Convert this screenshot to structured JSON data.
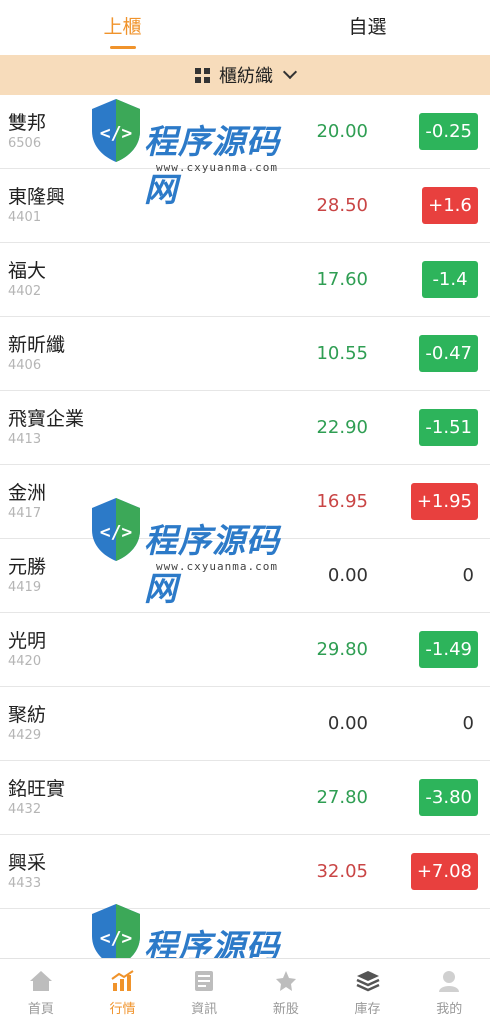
{
  "tabs": [
    {
      "label": "上櫃",
      "active": true
    },
    {
      "label": "自選",
      "active": false
    }
  ],
  "category": {
    "label": "櫃紡織"
  },
  "colors": {
    "accent": "#f0932b",
    "up": "#e8403e",
    "down": "#2db45b",
    "category_bg": "#f7dcbb"
  },
  "stocks": [
    {
      "name": "雙邦",
      "code": "6506",
      "price": "20.00",
      "change": "-0.25",
      "dir": "down"
    },
    {
      "name": "東隆興",
      "code": "4401",
      "price": "28.50",
      "change": "+1.6",
      "dir": "up"
    },
    {
      "name": "福大",
      "code": "4402",
      "price": "17.60",
      "change": "-1.4",
      "dir": "down"
    },
    {
      "name": "新昕纖",
      "code": "4406",
      "price": "10.55",
      "change": "-0.47",
      "dir": "down"
    },
    {
      "name": "飛寶企業",
      "code": "4413",
      "price": "22.90",
      "change": "-1.51",
      "dir": "down"
    },
    {
      "name": "金洲",
      "code": "4417",
      "price": "16.95",
      "change": "+1.95",
      "dir": "up"
    },
    {
      "name": "元勝",
      "code": "4419",
      "price": "0.00",
      "change": "0",
      "dir": "flat"
    },
    {
      "name": "光明",
      "code": "4420",
      "price": "29.80",
      "change": "-1.49",
      "dir": "down"
    },
    {
      "name": "聚紡",
      "code": "4429",
      "price": "0.00",
      "change": "0",
      "dir": "flat"
    },
    {
      "name": "銘旺實",
      "code": "4432",
      "price": "27.80",
      "change": "-3.80",
      "dir": "down"
    },
    {
      "name": "興采",
      "code": "4433",
      "price": "32.05",
      "change": "+7.08",
      "dir": "up"
    }
  ],
  "nav": [
    {
      "label": "首頁",
      "icon": "home-icon",
      "active": false
    },
    {
      "label": "行情",
      "icon": "chart-icon",
      "active": true
    },
    {
      "label": "資訊",
      "icon": "news-icon",
      "active": false
    },
    {
      "label": "新股",
      "icon": "new-stock-icon",
      "active": false
    },
    {
      "label": "庫存",
      "icon": "layers-icon",
      "active": false
    },
    {
      "label": "我的",
      "icon": "user-icon",
      "active": false
    }
  ],
  "watermark": {
    "title": "程序源码网",
    "url": "www.cxyuanma.com"
  }
}
